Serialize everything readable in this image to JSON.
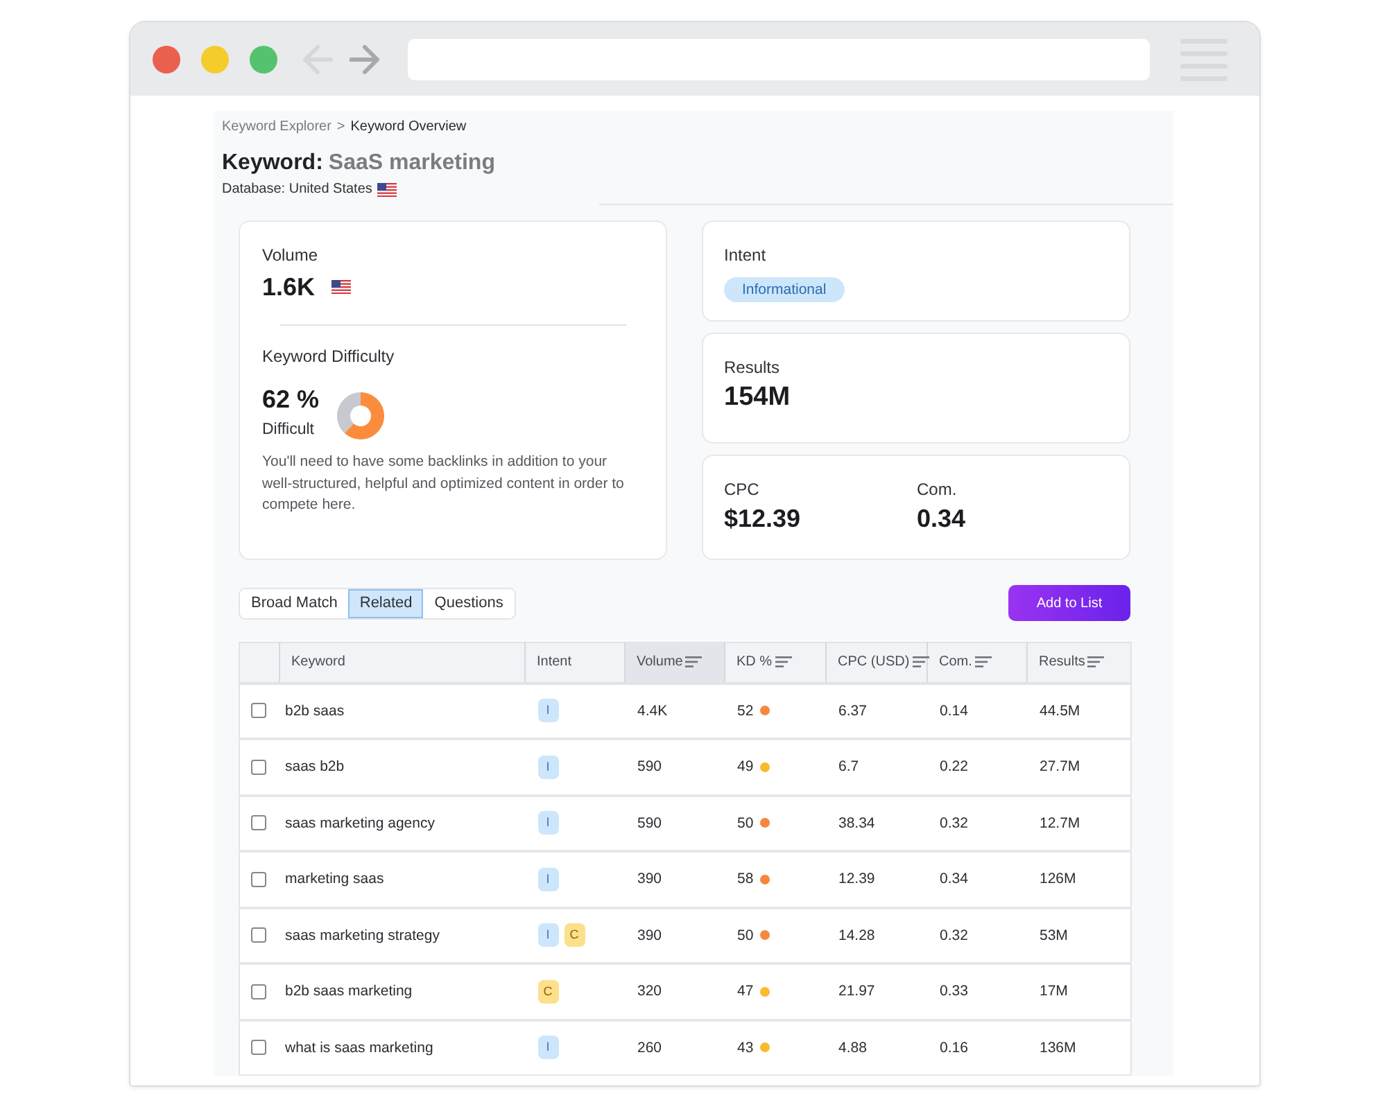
{
  "browser": {
    "back": {
      "disabled": true
    },
    "forward": {
      "disabled": false
    }
  },
  "breadcrumb": {
    "items": [
      "Keyword Explorer",
      "Keyword Overview"
    ],
    "separator": ">"
  },
  "heading": {
    "label": "Keyword:",
    "value": "SaaS marketing"
  },
  "database": {
    "label": "Database: United States"
  },
  "volume": {
    "label": "Volume",
    "value": "1.6K"
  },
  "difficulty": {
    "label": "Keyword Difficulty",
    "value": "62 %",
    "rating": "Difficult",
    "chart_data": {
      "type": "donut",
      "values": [
        62,
        38
      ]
    },
    "description": "You'll need to have some backlinks in addition to your well-structured, helpful and optimized content in order to compete here."
  },
  "intent": {
    "label": "Intent",
    "tags": [
      {
        "text": "Informational",
        "kind": "informational"
      }
    ]
  },
  "results": {
    "label": "Results",
    "value": "154M"
  },
  "cpc": {
    "label": "CPC",
    "value": "$12.39"
  },
  "competition": {
    "label": "Com.",
    "value": "0.34"
  },
  "tabs": [
    {
      "label": "Broad Match",
      "selected": false
    },
    {
      "label": "Related",
      "selected": true
    },
    {
      "label": "Questions",
      "selected": false
    }
  ],
  "add_button": {
    "label": "Add to List"
  },
  "table": {
    "columns": [
      {
        "label": "Keyword",
        "sortable": false,
        "sorted": false
      },
      {
        "label": "Intent",
        "sortable": false,
        "sorted": false
      },
      {
        "label": "Volume",
        "sortable": true,
        "sorted": true
      },
      {
        "label": "KD %",
        "sortable": true,
        "sorted": false
      },
      {
        "label": "CPC (USD)",
        "sortable": true,
        "sorted": false
      },
      {
        "label": "Com.",
        "sortable": true,
        "sorted": false
      },
      {
        "label": "Results",
        "sortable": true,
        "sorted": false
      }
    ],
    "rows": [
      {
        "checked": false,
        "keyword": "b2b saas",
        "intents": [
          {
            "text": "I",
            "kind": "informational"
          }
        ],
        "volume": "4.4K",
        "kd": {
          "value": "52",
          "color": "#f7873c"
        },
        "cpc": "6.37",
        "com": "0.14",
        "results": "44.5M"
      },
      {
        "checked": false,
        "keyword": "saas b2b",
        "intents": [
          {
            "text": "I",
            "kind": "informational"
          }
        ],
        "volume": "590",
        "kd": {
          "value": "49",
          "color": "#fbb92e"
        },
        "cpc": "6.7",
        "com": "0.22",
        "results": "27.7M"
      },
      {
        "checked": false,
        "keyword": "saas marketing agency",
        "intents": [
          {
            "text": "I",
            "kind": "informational"
          }
        ],
        "volume": "590",
        "kd": {
          "value": "50",
          "color": "#f7873c"
        },
        "cpc": "38.34",
        "com": "0.32",
        "results": "12.7M"
      },
      {
        "checked": false,
        "keyword": "marketing saas",
        "intents": [
          {
            "text": "I",
            "kind": "informational"
          }
        ],
        "volume": "390",
        "kd": {
          "value": "58",
          "color": "#f7873c"
        },
        "cpc": "12.39",
        "com": "0.34",
        "results": "126M"
      },
      {
        "checked": false,
        "keyword": "saas marketing strategy",
        "intents": [
          {
            "text": "I",
            "kind": "informational"
          },
          {
            "text": "C",
            "kind": "commercial"
          }
        ],
        "volume": "390",
        "kd": {
          "value": "50",
          "color": "#f7873c"
        },
        "cpc": "14.28",
        "com": "0.32",
        "results": "53M"
      },
      {
        "checked": false,
        "keyword": "b2b saas marketing",
        "intents": [
          {
            "text": "C",
            "kind": "commercial"
          }
        ],
        "volume": "320",
        "kd": {
          "value": "47",
          "color": "#fbb92e"
        },
        "cpc": "21.97",
        "com": "0.33",
        "results": "17M"
      },
      {
        "checked": false,
        "keyword": "what is saas marketing",
        "intents": [
          {
            "text": "I",
            "kind": "informational"
          }
        ],
        "volume": "260",
        "kd": {
          "value": "43",
          "color": "#fbb92e"
        },
        "cpc": "4.88",
        "com": "0.16",
        "results": "136M"
      }
    ]
  }
}
